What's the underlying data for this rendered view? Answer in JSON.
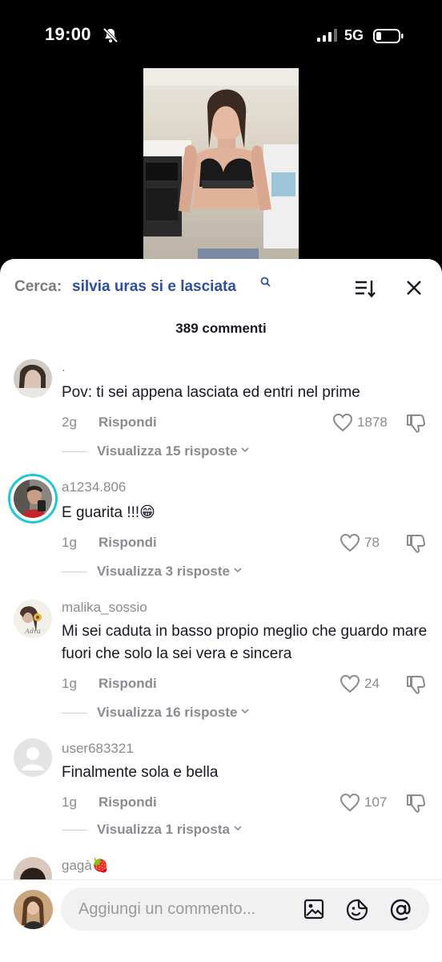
{
  "status_bar": {
    "time": "19:00",
    "network": "5G"
  },
  "search": {
    "label": "Cerca:",
    "query": "silvia uras si e lasciata"
  },
  "comments_count": "389 commenti",
  "comments": [
    {
      "username": ".",
      "text": "Pov: ti sei appena lasciata ed entri nel prime",
      "age": "2g",
      "reply_label": "Rispondi",
      "likes": "1878",
      "view_replies": "Visualizza 15 risposte"
    },
    {
      "username": "a1234.806",
      "text": "E guarita !!!😁",
      "age": "1g",
      "reply_label": "Rispondi",
      "likes": "78",
      "view_replies": "Visualizza 3 risposte"
    },
    {
      "username": "malika_sossio",
      "text": "Mi sei caduta in basso propio meglio che guardo mare fuori che solo la sei vera e sincera",
      "age": "1g",
      "reply_label": "Rispondi",
      "likes": "24",
      "view_replies": "Visualizza 16 risposte"
    },
    {
      "username": "user683321",
      "text": "Finalmente sola e bella",
      "age": "1g",
      "reply_label": "Rispondi",
      "likes": "107",
      "view_replies": "Visualizza 1 risposta"
    },
    {
      "username": "gagà🍓"
    }
  ],
  "composer": {
    "placeholder": "Aggiungi un commento..."
  },
  "colors": {
    "accent_blue": "#2f4f9e",
    "ring": "#20c7d8",
    "muted": "#8a8b91",
    "text": "#161823"
  }
}
